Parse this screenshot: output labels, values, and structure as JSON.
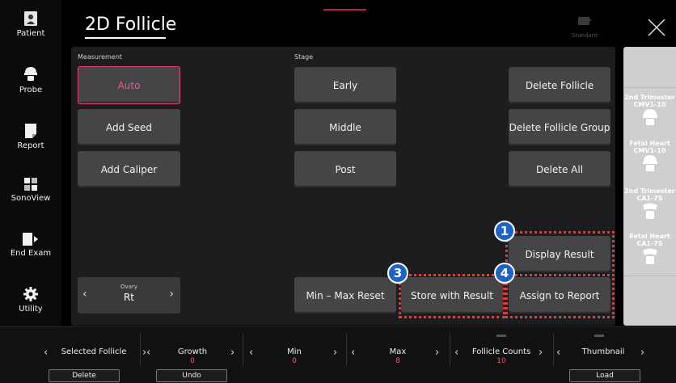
{
  "sidebar": {
    "items": [
      {
        "label": "Patient",
        "icon": "patient-icon"
      },
      {
        "label": "Probe",
        "icon": "probe-icon"
      },
      {
        "label": "Report",
        "icon": "report-icon"
      },
      {
        "label": "SonoView",
        "icon": "sonoview-icon"
      },
      {
        "label": "End Exam",
        "icon": "end-exam-icon"
      },
      {
        "label": "Utility",
        "icon": "utility-icon"
      }
    ]
  },
  "header": {
    "title": "2D Follicle",
    "preset_label": "Standard"
  },
  "measurement": {
    "section_label": "Measurement",
    "buttons": [
      "Auto",
      "Add Seed",
      "Add Caliper"
    ],
    "active": "Auto"
  },
  "stage": {
    "section_label": "Stage",
    "buttons": [
      "Early",
      "Middle",
      "Post"
    ]
  },
  "actions": {
    "buttons": [
      "Delete Follicle",
      "Delete Follicle Group",
      "Delete All"
    ],
    "display_result": "Display Result",
    "min_max_reset": "Min – Max Reset",
    "store_with_result": "Store with Result",
    "assign_to_report": "Assign to Report"
  },
  "ovary": {
    "label": "Ovary",
    "value": "Rt"
  },
  "callouts": [
    "1",
    "3",
    "4"
  ],
  "probes": [
    {
      "label": "2nd Trimester CMV1-10"
    },
    {
      "label": "Fetal Heart CMV1-10"
    },
    {
      "label": "2nd Trimester CA1-7S"
    },
    {
      "label": "Fetal Heart CA1-7S"
    }
  ],
  "bottom_bar": [
    {
      "name": "Selected Follicle",
      "value": "",
      "button": "Delete"
    },
    {
      "name": "Growth",
      "value": "0",
      "button": "Undo"
    },
    {
      "name": "Min",
      "value": "0",
      "button": ""
    },
    {
      "name": "Max",
      "value": "8",
      "button": ""
    },
    {
      "name": "Follicle Counts",
      "value": "10",
      "button": ""
    },
    {
      "name": "Thumbnail",
      "value": "",
      "button": "Load"
    }
  ],
  "colors": {
    "accent": "#e0457b",
    "callout_badge": "#1b63c6",
    "highlight_dots": "#e53935",
    "value_text": "#ff5a5f"
  }
}
